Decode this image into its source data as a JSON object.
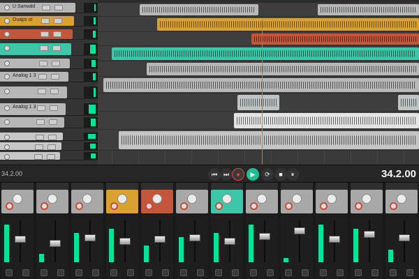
{
  "transport": {
    "position_left": "34.2.00",
    "position_right": "34.2.00",
    "buttons": [
      {
        "name": "skip-start-icon",
        "glyph": "⏮"
      },
      {
        "name": "skip-end-icon",
        "glyph": "⏭"
      },
      {
        "name": "record-icon",
        "glyph": "●"
      },
      {
        "name": "play-icon",
        "glyph": "▶"
      },
      {
        "name": "repeat-icon",
        "glyph": "⟳"
      },
      {
        "name": "stop-icon",
        "glyph": "■"
      },
      {
        "name": "pause-icon",
        "glyph": "⏸"
      }
    ]
  },
  "tracks": {
    "names": [
      "U Sarwald",
      "Ouaps ut",
      "",
      "",
      "",
      "Analog 1 3",
      "",
      "Analog 1 3",
      "",
      "",
      "",
      ""
    ],
    "colors": [
      "#b7b7b7",
      "#d9a12e",
      "#c2553a",
      "#3ec6a8",
      "#b7b7b7",
      "#b7b7b7",
      "#b7b7b7",
      "#b7b7b7",
      "#b7b7b7",
      "#c8c8c8",
      "#c8c8c8",
      "#c8c8c8"
    ],
    "meter_levels": [
      0.1,
      0.2,
      0.3,
      0.6,
      0.4,
      0.3,
      0.2,
      0.7,
      0.5,
      0.8,
      0.6,
      0.5
    ]
  },
  "mixer": {
    "strip_colors": [
      "#a8a8a8",
      "#a8a8a8",
      "#a8a8a8",
      "#d9a12e",
      "#c2553a",
      "#a8a8a8",
      "#3ec6a8",
      "#a8a8a8",
      "#a8a8a8",
      "#a8a8a8",
      "#a8a8a8",
      "#a8a8a8"
    ],
    "fader_levels": [
      0.55,
      0.45,
      0.6,
      0.5,
      0.55,
      0.6,
      0.5,
      0.65,
      0.8,
      0.55,
      0.7,
      0.6
    ],
    "meter_levels": [
      0.9,
      0.2,
      0.7,
      0.8,
      0.4,
      0.6,
      0.7,
      0.9,
      0.1,
      0.9,
      0.8,
      0.3
    ],
    "brand_accent": "#00e59a"
  }
}
